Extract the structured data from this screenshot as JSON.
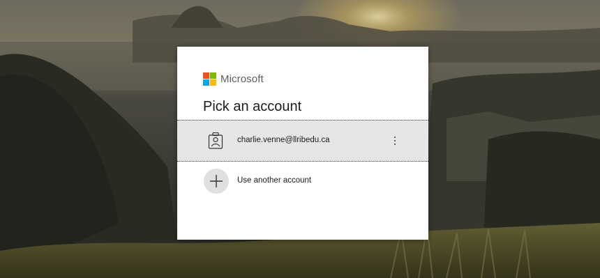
{
  "brand": {
    "name": "Microsoft",
    "logo_colors": [
      "#f25022",
      "#7fba00",
      "#00a4ef",
      "#ffb900"
    ]
  },
  "dialog": {
    "title": "Pick an account"
  },
  "accounts": [
    {
      "email": "charlie.venne@llribedu.ca",
      "icon": "badge-person-icon"
    }
  ],
  "other_account": {
    "label": "Use another account",
    "icon": "plus-icon"
  },
  "colors": {
    "card_background": "#ffffff",
    "selected_row": "#e6e6e6"
  }
}
